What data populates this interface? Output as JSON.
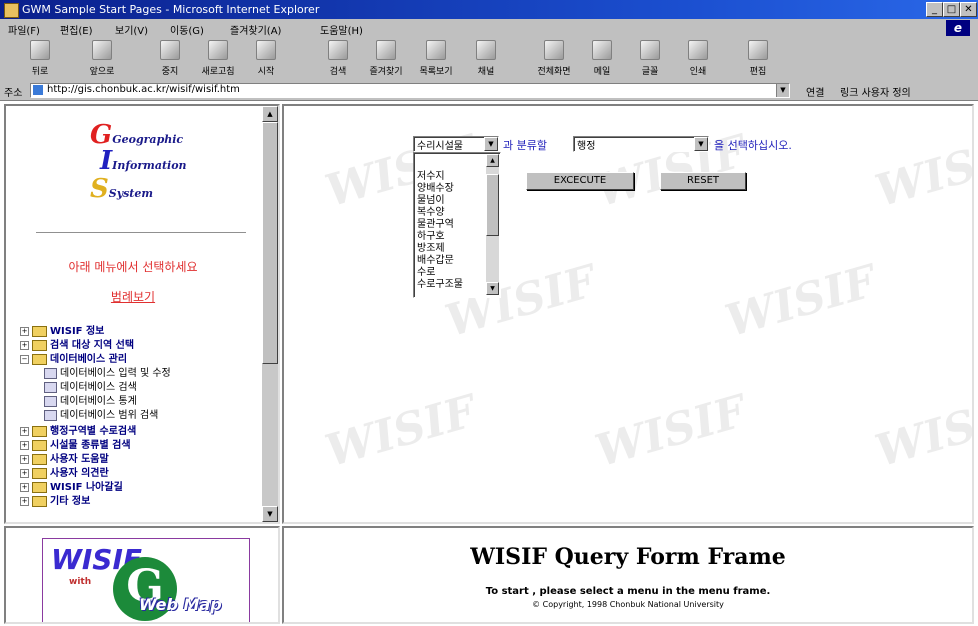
{
  "window": {
    "title": "GWM Sample Start Pages - Microsoft Internet Explorer",
    "controls": [
      "_",
      "□",
      "✕"
    ]
  },
  "menubar": {
    "items": [
      "파일(F)",
      "편집(E)",
      "보기(V)",
      "이동(G)",
      "즐겨찾기(A)",
      "도움말(H)"
    ]
  },
  "toolbar": {
    "buttons": [
      "뒤로",
      "앞으로",
      "중지",
      "새로고침",
      "시작",
      "검색",
      "즐겨찾기",
      "목록보기",
      "채널",
      "전체화면",
      "메일",
      "글꼴",
      "인쇄",
      "편집"
    ]
  },
  "addressbar": {
    "label": "주소",
    "url": "http://gis.chonbuk.ac.kr/wisif/wisif.htm",
    "go_label": "연결",
    "links_label": "링크 사용자 정의"
  },
  "left_frame": {
    "logo": {
      "line1": "Geographic",
      "line2": "Information",
      "line3": "System"
    },
    "prompt": "아래 메뉴에서 선택하세요",
    "legend_link": "범례보기",
    "tree": [
      {
        "toggle": "+",
        "label": "WISIF 정보",
        "type": "folder"
      },
      {
        "toggle": "+",
        "label": "검색 대상 지역 선택",
        "type": "folder"
      },
      {
        "toggle": "−",
        "label": "데이터베이스 관리",
        "type": "folder"
      },
      {
        "toggle": "",
        "label": "데이터베이스 입력 및 수정",
        "type": "doc"
      },
      {
        "toggle": "",
        "label": "데이터베이스 검색",
        "type": "doc"
      },
      {
        "toggle": "",
        "label": "데이터베이스 통계",
        "type": "doc"
      },
      {
        "toggle": "",
        "label": "데이터베이스 범위 검색",
        "type": "doc"
      },
      {
        "toggle": "+",
        "label": "행정구역별 수로검색",
        "type": "folder"
      },
      {
        "toggle": "+",
        "label": "시설물 종류별 검색",
        "type": "folder"
      },
      {
        "toggle": "+",
        "label": "사용자 도움말",
        "type": "folder"
      },
      {
        "toggle": "+",
        "label": "사용자 의견란",
        "type": "folder"
      },
      {
        "toggle": "+",
        "label": "WISIF 나아갈길",
        "type": "folder"
      },
      {
        "toggle": "+",
        "label": "기타 정보",
        "type": "folder"
      }
    ]
  },
  "query_frame": {
    "facility_select": "수리시설물",
    "text_between": "과 분류할",
    "region_select": "행정",
    "text_after": "을 선택하십시오.",
    "facility_list": [
      "저수지",
      "양배수장",
      "물넘이",
      "복수양",
      "물관구역",
      "하구호",
      "방조제",
      "배수갑문",
      "수로",
      "수로구조물"
    ],
    "execute_label": "EXCECUTE",
    "reset_label": "RESET",
    "watermark": "WISIF"
  },
  "logo_frame": {
    "brand": "WISIF",
    "with": "with",
    "g": "G",
    "webmap": "Web Map"
  },
  "info_frame": {
    "title": "WISIF Query Form Frame",
    "subtitle": "To start , please select a menu in the menu frame.",
    "copyright": "© Copyright, 1998 Chonbuk National University"
  }
}
